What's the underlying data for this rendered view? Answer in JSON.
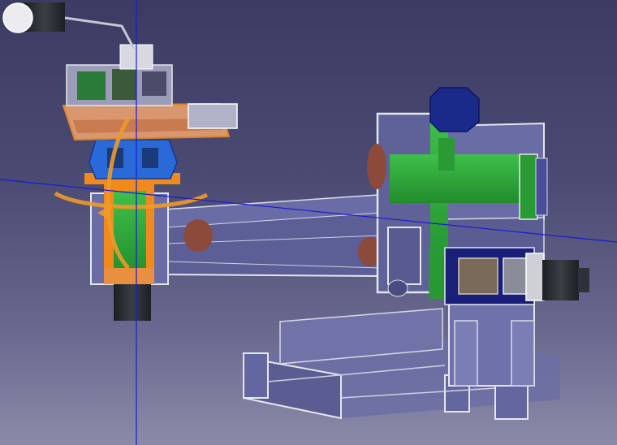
{
  "viewport": {
    "background_top": "#3b3b63",
    "background_bottom": "#8a8aa8",
    "axis_color": "#1a1ad8",
    "compass_icon": "view-compass-icon"
  },
  "colors": {
    "structure_fill": "#5d5f96",
    "structure_edge": "#e6e6ee",
    "highlight_green": "#2fa83a",
    "cross_section_orange": "#f08a1c",
    "part_blue": "#1e5ad0",
    "motor_dark": "#2a2e34",
    "navy_part": "#1a1f7a",
    "cable_red": "#8b4a3a"
  }
}
